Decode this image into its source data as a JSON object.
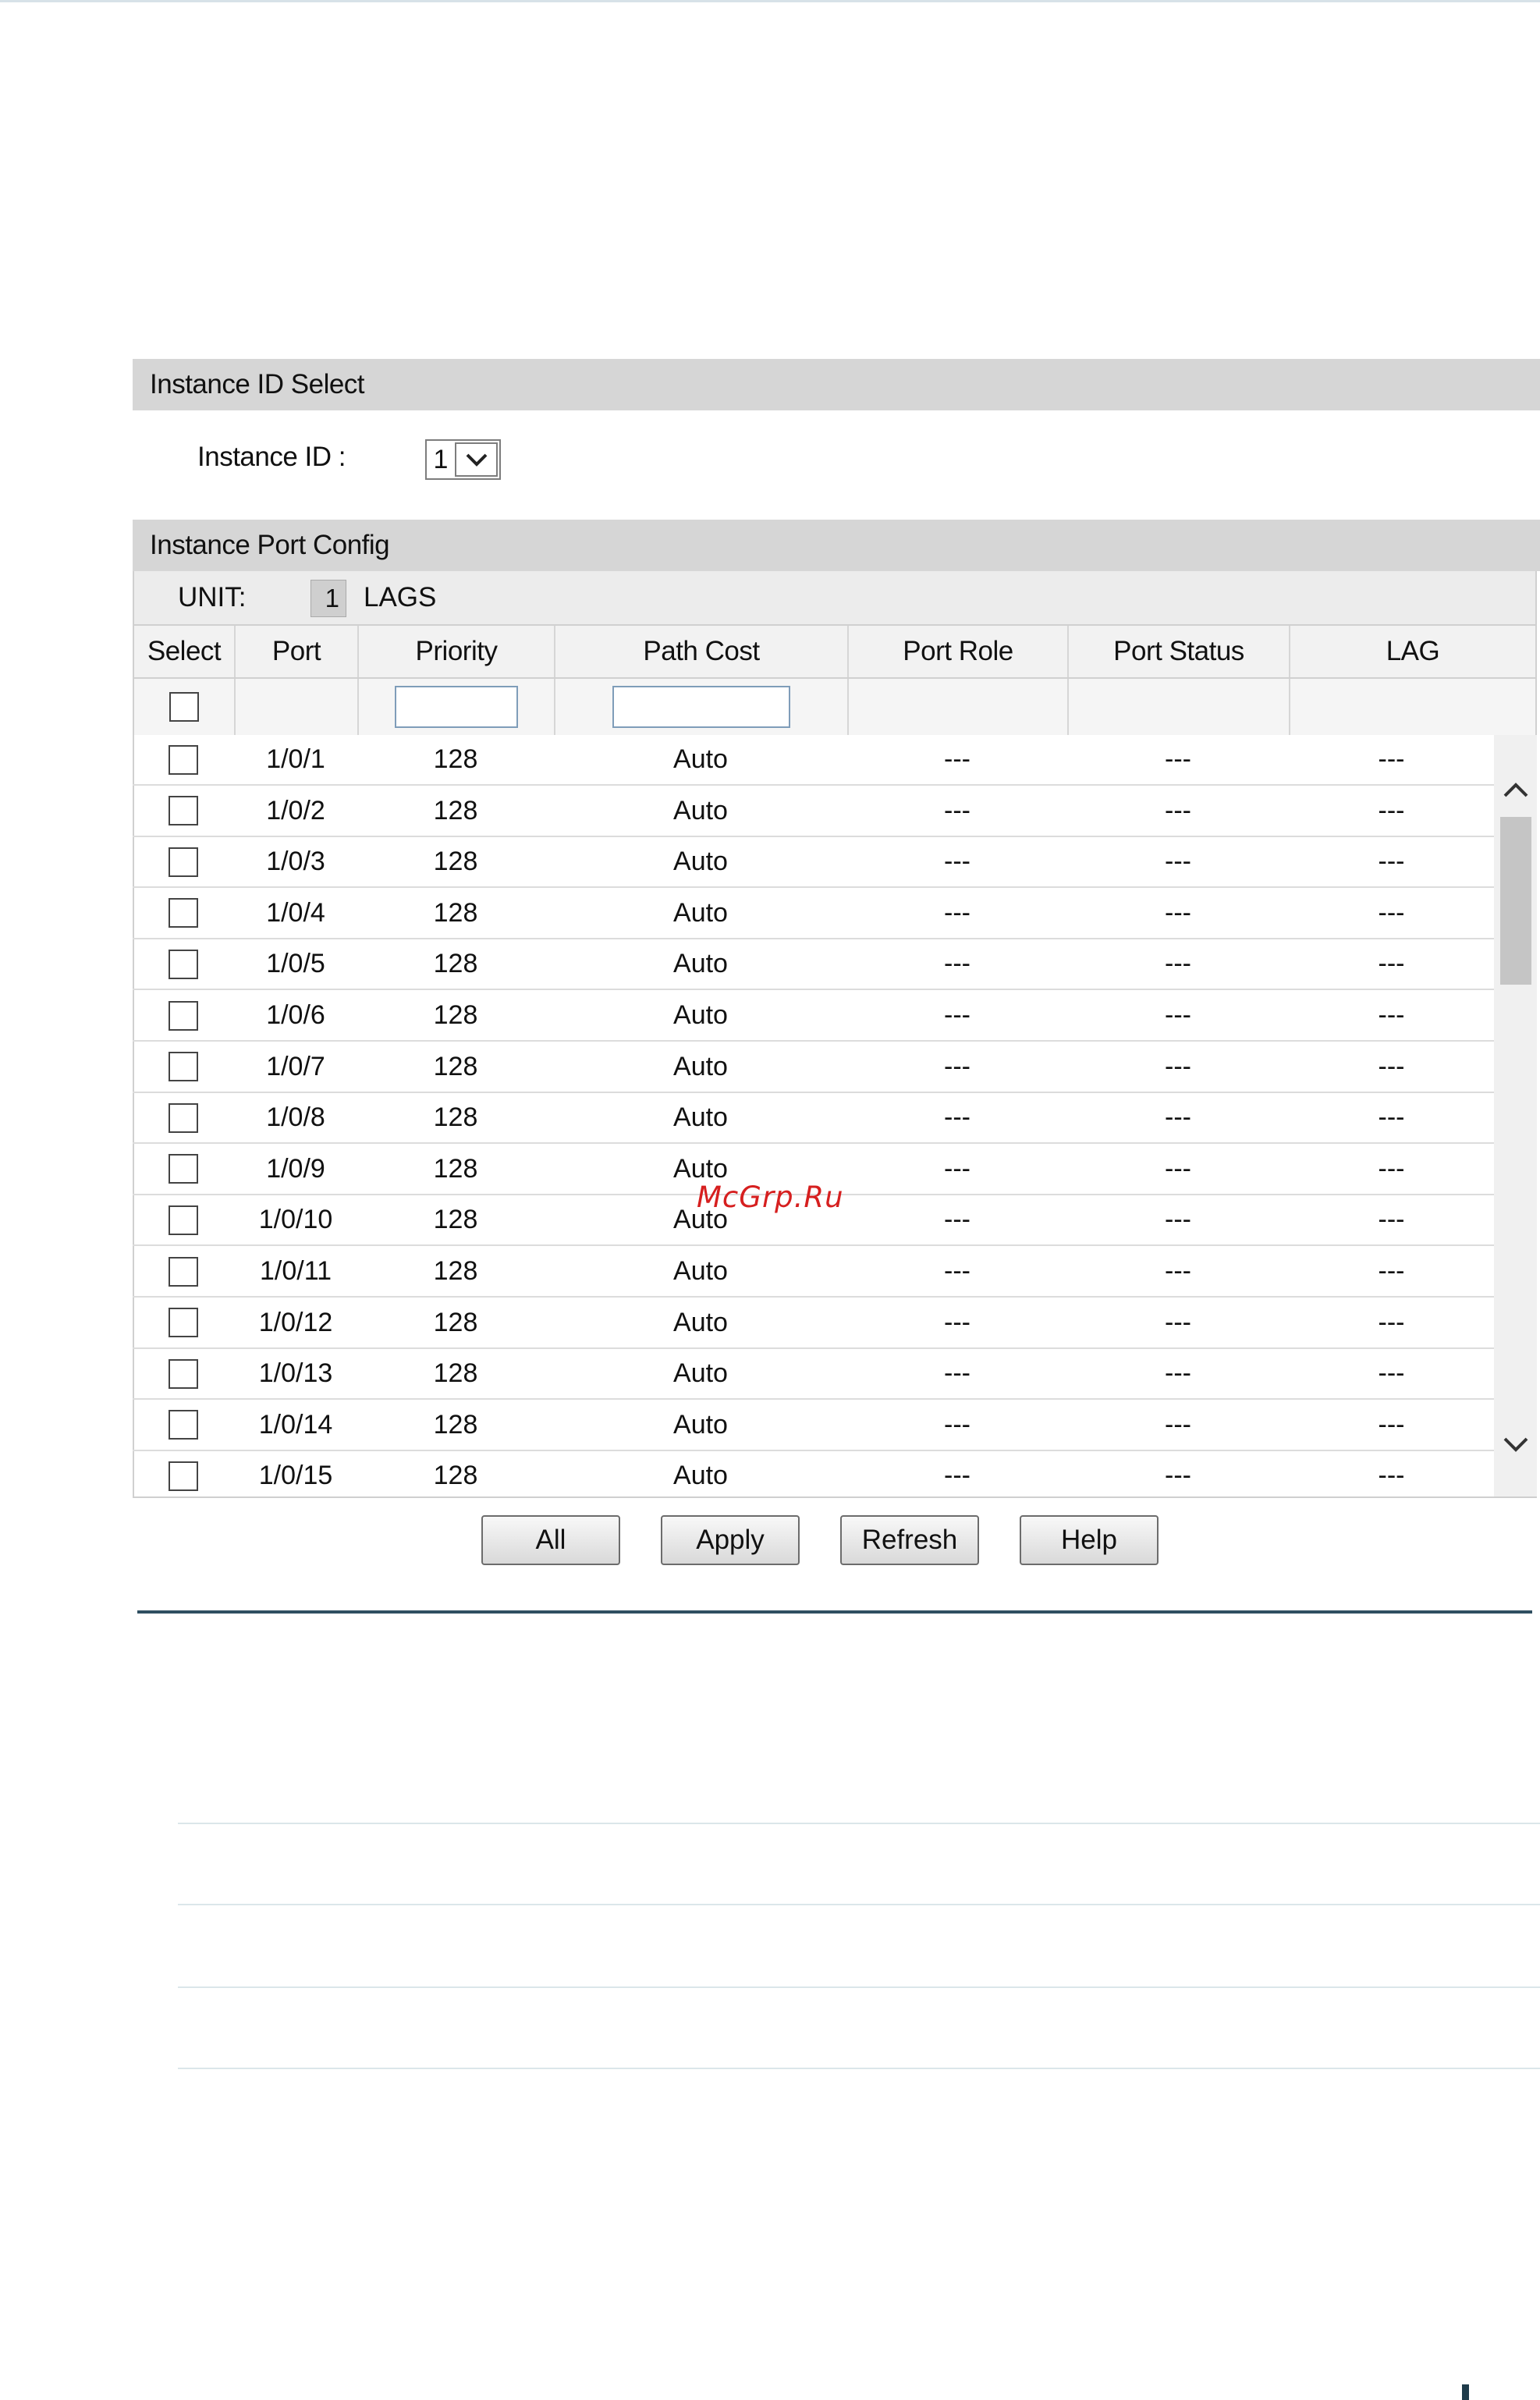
{
  "instance_select": {
    "header": "Instance ID Select",
    "label": "Instance ID :",
    "selected_value": "1"
  },
  "port_config": {
    "header": "Instance Port Config",
    "unit_label": "UNIT:",
    "unit_value": "1",
    "lags_label": "LAGS",
    "columns": [
      "Select",
      "Port",
      "Priority",
      "Path Cost",
      "Port Role",
      "Port Status",
      "LAG"
    ],
    "rows": [
      {
        "port": "1/0/1",
        "priority": "128",
        "path_cost": "Auto",
        "port_role": "---",
        "port_status": "---",
        "lag": "---"
      },
      {
        "port": "1/0/2",
        "priority": "128",
        "path_cost": "Auto",
        "port_role": "---",
        "port_status": "---",
        "lag": "---"
      },
      {
        "port": "1/0/3",
        "priority": "128",
        "path_cost": "Auto",
        "port_role": "---",
        "port_status": "---",
        "lag": "---"
      },
      {
        "port": "1/0/4",
        "priority": "128",
        "path_cost": "Auto",
        "port_role": "---",
        "port_status": "---",
        "lag": "---"
      },
      {
        "port": "1/0/5",
        "priority": "128",
        "path_cost": "Auto",
        "port_role": "---",
        "port_status": "---",
        "lag": "---"
      },
      {
        "port": "1/0/6",
        "priority": "128",
        "path_cost": "Auto",
        "port_role": "---",
        "port_status": "---",
        "lag": "---"
      },
      {
        "port": "1/0/7",
        "priority": "128",
        "path_cost": "Auto",
        "port_role": "---",
        "port_status": "---",
        "lag": "---"
      },
      {
        "port": "1/0/8",
        "priority": "128",
        "path_cost": "Auto",
        "port_role": "---",
        "port_status": "---",
        "lag": "---"
      },
      {
        "port": "1/0/9",
        "priority": "128",
        "path_cost": "Auto",
        "port_role": "---",
        "port_status": "---",
        "lag": "---"
      },
      {
        "port": "1/0/10",
        "priority": "128",
        "path_cost": "Auto",
        "port_role": "---",
        "port_status": "---",
        "lag": "---"
      },
      {
        "port": "1/0/11",
        "priority": "128",
        "path_cost": "Auto",
        "port_role": "---",
        "port_status": "---",
        "lag": "---"
      },
      {
        "port": "1/0/12",
        "priority": "128",
        "path_cost": "Auto",
        "port_role": "---",
        "port_status": "---",
        "lag": "---"
      },
      {
        "port": "1/0/13",
        "priority": "128",
        "path_cost": "Auto",
        "port_role": "---",
        "port_status": "---",
        "lag": "---"
      },
      {
        "port": "1/0/14",
        "priority": "128",
        "path_cost": "Auto",
        "port_role": "---",
        "port_status": "---",
        "lag": "---"
      },
      {
        "port": "1/0/15",
        "priority": "128",
        "path_cost": "Auto",
        "port_role": "---",
        "port_status": "---",
        "lag": "---"
      }
    ]
  },
  "buttons": {
    "all": "All",
    "apply": "Apply",
    "refresh": "Refresh",
    "help": "Help"
  },
  "watermark": "McGrp.Ru",
  "icons": {
    "dropdown": "chevron-down-icon",
    "scroll_up": "chevron-up-icon",
    "scroll_down": "chevron-down-icon"
  }
}
